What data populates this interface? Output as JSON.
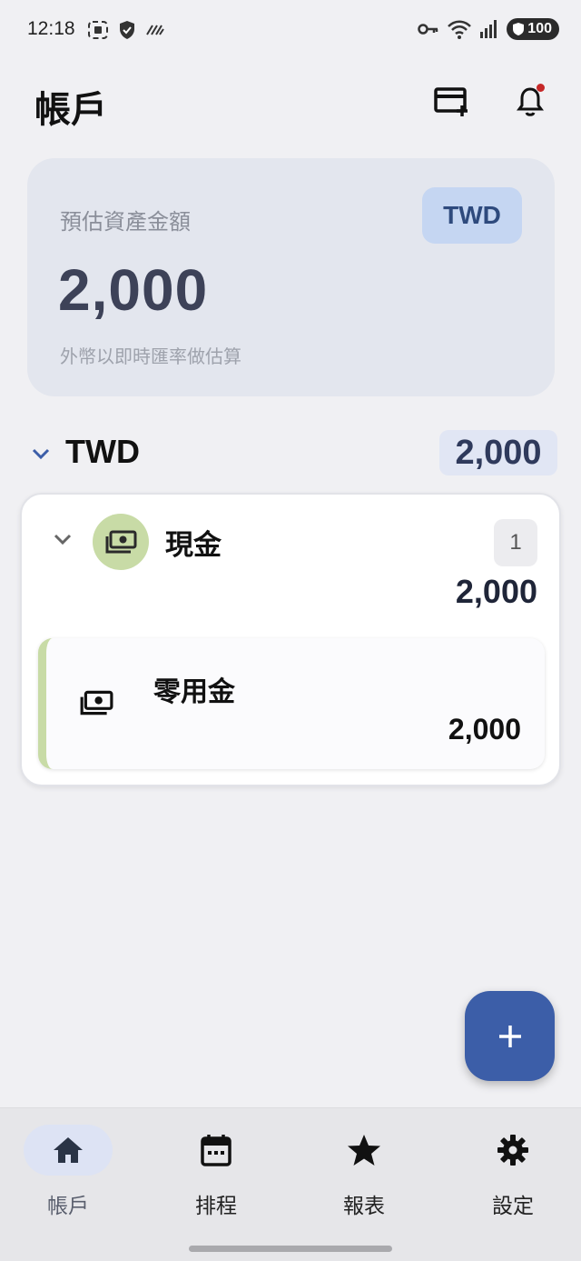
{
  "status_bar": {
    "time": "12:18",
    "battery": "100",
    "icons": [
      "screenshot-icon",
      "shield-icon",
      "data-saver-icon",
      "vpn-key-icon",
      "wifi-icon",
      "signal-icon",
      "battery-icon"
    ]
  },
  "header": {
    "title": "帳戶",
    "actions": [
      "add-card-icon",
      "bell-icon"
    ]
  },
  "summary": {
    "label": "預估資產金額",
    "amount": "2,000",
    "currency": "TWD",
    "note": "外幣以即時匯率做估算"
  },
  "currency_group": {
    "code": "TWD",
    "total": "2,000"
  },
  "category": {
    "name": "現金",
    "count": "1",
    "total": "2,000",
    "icon": "cash-icon",
    "color": "#c8dba6"
  },
  "account": {
    "name": "零用金",
    "balance": "2,000",
    "icon": "cash-icon"
  },
  "fab": {
    "icon": "plus-icon"
  },
  "bottom_nav": {
    "items": [
      {
        "label": "帳戶",
        "icon": "home-icon",
        "active": true
      },
      {
        "label": "排程",
        "icon": "calendar-icon",
        "active": false
      },
      {
        "label": "報表",
        "icon": "star-icon",
        "active": false
      },
      {
        "label": "設定",
        "icon": "gear-icon",
        "active": false
      }
    ]
  },
  "colors": {
    "accent": "#3c5ea8",
    "summary_bg": "#e3e6ee",
    "chip_bg": "#c5d6f2",
    "category_green": "#c8dba6",
    "notification_dot": "#c62828"
  }
}
